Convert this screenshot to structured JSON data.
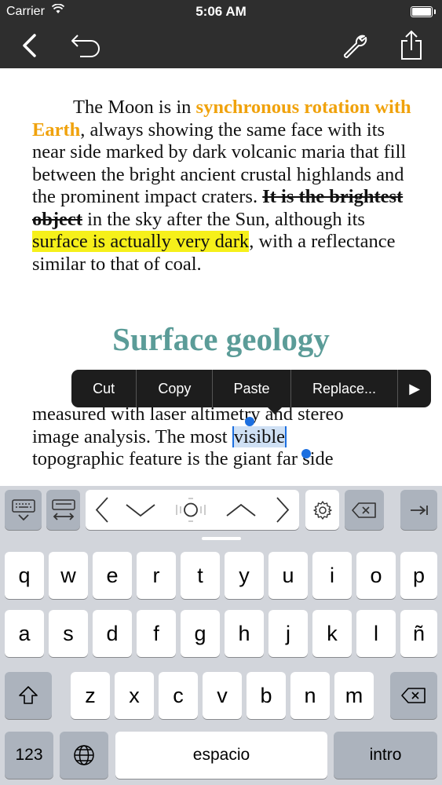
{
  "status_bar": {
    "carrier": "Carrier",
    "time": "5:06 AM"
  },
  "nav": {
    "back_icon": "chevron-left-icon",
    "undo_icon": "undo-icon",
    "settings_icon": "wrench-icon",
    "share_icon": "share-icon"
  },
  "document": {
    "p1": {
      "part1": "The Moon is in ",
      "link": "synchronous rotation with Earth",
      "part2": ", always showing the same face with its near side marked by dark volcanic maria that fill between the bright ancient crustal highlands and the prominent impact craters. ",
      "strike": "It is the brightest object",
      "part3": " in the sky after the Sun, although its ",
      "highlight": "surface is actually very dark",
      "part4": ", with a reflectance similar to that of coal."
    },
    "heading": "Surface geology",
    "p2": {
      "line1": "measured with laser altimetry and stereo",
      "part1": "image analysis. The most ",
      "selected": "visible",
      "line3": "topographic feature is the giant far side"
    }
  },
  "edit_menu": {
    "cut": "Cut",
    "copy": "Copy",
    "paste": "Paste",
    "replace": "Replace...",
    "more": "▶"
  },
  "colors": {
    "accent": "#f0a20c",
    "highlight": "#f6f01a",
    "heading": "#5b9c98",
    "selection": "#1c6fe0",
    "bar": "#2e2e2e"
  },
  "keyboard": {
    "row1": [
      "q",
      "w",
      "e",
      "r",
      "t",
      "y",
      "u",
      "i",
      "o",
      "p"
    ],
    "row2": [
      "a",
      "s",
      "d",
      "f",
      "g",
      "h",
      "j",
      "k",
      "l",
      "ñ"
    ],
    "row3": [
      "z",
      "x",
      "c",
      "v",
      "b",
      "n",
      "m"
    ],
    "numbers": "123",
    "space": "espacio",
    "return": "intro"
  }
}
